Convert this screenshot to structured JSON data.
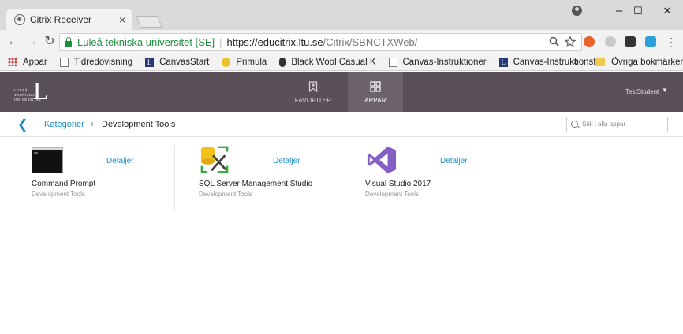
{
  "browser": {
    "tab_title": "Citrix Receiver",
    "tab_close": "×",
    "window_controls": {
      "minimize": "–",
      "maximize": "☐",
      "close": "✕"
    },
    "secure_label": "Luleå tekniska universitet [SE]",
    "separator": "|",
    "url_host": "https://educitrix.ltu.se",
    "url_path": "/Citrix/SBNCTXWeb/",
    "bookmarks": [
      {
        "label": "Appar",
        "icon": "apps-grid-icon"
      },
      {
        "label": "Tidredovisning",
        "icon": "page-icon"
      },
      {
        "label": "CanvasStart",
        "icon": "ltu-icon"
      },
      {
        "label": "Primula",
        "icon": "primula-icon"
      },
      {
        "label": "Black Wool Casual K",
        "icon": "microphone-icon"
      },
      {
        "label": "Canvas-Instruktioner",
        "icon": "page-icon"
      },
      {
        "label": "Canvas-Instruktionsf",
        "icon": "ltu-icon"
      }
    ],
    "bookmarks_overflow": "»",
    "other_bookmarks": "Övriga bokmärken",
    "ltu_letter": "L"
  },
  "header": {
    "logo_letter": "L",
    "logo_text": "LULEÅ TEKNISKA UNIVERSITET",
    "tabs": [
      {
        "label": "FAVORITER",
        "active": false
      },
      {
        "label": "APPAR",
        "active": true
      }
    ],
    "user": "TestStudent",
    "user_caret": "▼"
  },
  "breadcrumb": {
    "back": "❮",
    "parent": "Kategorier",
    "chevron": "›",
    "current": "Development Tools",
    "search_placeholder": "Sök i alla appar"
  },
  "apps": [
    {
      "name": "Command Prompt",
      "category": "Development Tools",
      "details": "Detaljer",
      "icon": "command-prompt-icon"
    },
    {
      "name": "SQL Server Management Studio",
      "category": "Development Tools",
      "details": "Detaljer",
      "icon": "sql-server-icon"
    },
    {
      "name": "Visual Studio 2017",
      "category": "Development Tools",
      "details": "Detaljer",
      "icon": "visual-studio-icon"
    }
  ],
  "colors": {
    "header_bg": "#5a5059",
    "link": "#1f8fc4",
    "secure": "#1e8e3e",
    "vs_purple": "#865fc5"
  }
}
